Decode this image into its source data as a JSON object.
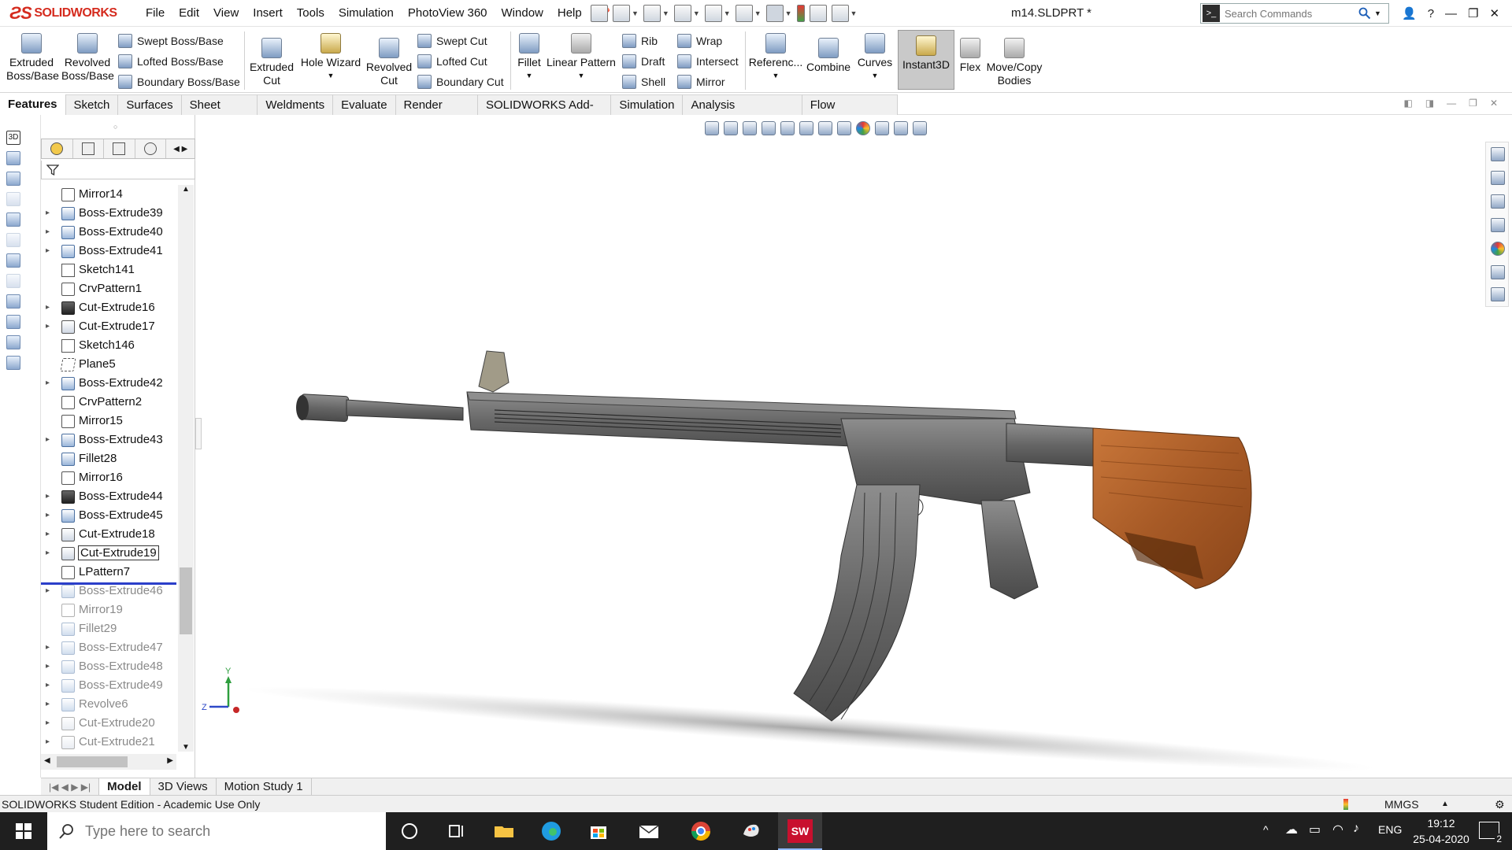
{
  "app": {
    "brand": "SOLIDWORKS",
    "doc_title": "m14.SLDPRT *"
  },
  "menu": [
    "File",
    "Edit",
    "View",
    "Insert",
    "Tools",
    "Simulation",
    "PhotoView 360",
    "Window",
    "Help"
  ],
  "search": {
    "placeholder": "Search Commands"
  },
  "toolbar": {
    "extruded_boss": [
      "Extruded",
      "Boss/Base"
    ],
    "revolved_boss": [
      "Revolved",
      "Boss/Base"
    ],
    "swept_boss": "Swept Boss/Base",
    "lofted_boss": "Lofted Boss/Base",
    "boundary_boss": "Boundary Boss/Base",
    "extruded_cut": [
      "Extruded",
      "Cut"
    ],
    "hole_wizard": "Hole Wizard",
    "revolved_cut": [
      "Revolved",
      "Cut"
    ],
    "swept_cut": "Swept Cut",
    "lofted_cut": "Lofted Cut",
    "boundary_cut": "Boundary Cut",
    "fillet": "Fillet",
    "linear_pattern": "Linear Pattern",
    "rib": "Rib",
    "draft": "Draft",
    "shell": "Shell",
    "wrap": "Wrap",
    "intersect": "Intersect",
    "mirror": "Mirror",
    "reference": "Referenc...",
    "combine": "Combine",
    "curves": "Curves",
    "instant3d": "Instant3D",
    "flex": "Flex",
    "move_copy": [
      "Move/Copy",
      "Bodies"
    ]
  },
  "tabs": [
    "Features",
    "Sketch",
    "Surfaces",
    "Sheet Metal",
    "Weldments",
    "Evaluate",
    "Render Tools",
    "SOLIDWORKS Add-Ins",
    "Simulation",
    "Analysis Preparation",
    "Flow Simulation"
  ],
  "tree": [
    {
      "label": "Mirror14",
      "kind": "pattern",
      "expandable": false
    },
    {
      "label": "Boss-Extrude39",
      "kind": "boss",
      "expandable": true
    },
    {
      "label": "Boss-Extrude40",
      "kind": "boss",
      "expandable": true
    },
    {
      "label": "Boss-Extrude41",
      "kind": "boss",
      "expandable": true
    },
    {
      "label": "Sketch141",
      "kind": "sketch",
      "expandable": false
    },
    {
      "label": "CrvPattern1",
      "kind": "pattern",
      "expandable": false
    },
    {
      "label": "Cut-Extrude16",
      "kind": "dark",
      "expandable": true
    },
    {
      "label": "Cut-Extrude17",
      "kind": "cut",
      "expandable": true
    },
    {
      "label": "Sketch146",
      "kind": "sketch",
      "expandable": false
    },
    {
      "label": "Plane5",
      "kind": "plane",
      "expandable": false
    },
    {
      "label": "Boss-Extrude42",
      "kind": "boss",
      "expandable": true
    },
    {
      "label": "CrvPattern2",
      "kind": "pattern",
      "expandable": false
    },
    {
      "label": "Mirror15",
      "kind": "pattern",
      "expandable": false
    },
    {
      "label": "Boss-Extrude43",
      "kind": "boss",
      "expandable": true
    },
    {
      "label": "Fillet28",
      "kind": "boss",
      "expandable": false
    },
    {
      "label": "Mirror16",
      "kind": "pattern",
      "expandable": false
    },
    {
      "label": "Boss-Extrude44",
      "kind": "dark",
      "expandable": true
    },
    {
      "label": "Boss-Extrude45",
      "kind": "boss",
      "expandable": true
    },
    {
      "label": "Cut-Extrude18",
      "kind": "cut",
      "expandable": true
    },
    {
      "label": "Cut-Extrude19",
      "kind": "cut",
      "expandable": true,
      "selected": true
    },
    {
      "label": "LPattern7",
      "kind": "pattern",
      "expandable": false
    },
    {
      "label": "Boss-Extrude46",
      "kind": "boss",
      "expandable": true,
      "suppressed": true
    },
    {
      "label": "Mirror19",
      "kind": "pattern",
      "expandable": false,
      "suppressed": true
    },
    {
      "label": "Fillet29",
      "kind": "boss",
      "expandable": false,
      "suppressed": true
    },
    {
      "label": "Boss-Extrude47",
      "kind": "boss",
      "expandable": true,
      "suppressed": true
    },
    {
      "label": "Boss-Extrude48",
      "kind": "boss",
      "expandable": true,
      "suppressed": true
    },
    {
      "label": "Boss-Extrude49",
      "kind": "boss",
      "expandable": true,
      "suppressed": true
    },
    {
      "label": "Revolve6",
      "kind": "boss",
      "expandable": true,
      "suppressed": true
    },
    {
      "label": "Cut-Extrude20",
      "kind": "cut",
      "expandable": true,
      "suppressed": true
    },
    {
      "label": "Cut-Extrude21",
      "kind": "cut",
      "expandable": true,
      "suppressed": true
    }
  ],
  "bottom_tabs": [
    "Model",
    "3D Views",
    "Motion Study 1"
  ],
  "status": {
    "left": "SOLIDWORKS Student Edition - Academic Use Only",
    "units": "MMGS"
  },
  "triad": {
    "y": "Y",
    "z": "Z"
  },
  "taskbar": {
    "search_placeholder": "Type here to search",
    "lang": "ENG",
    "time": "19:12",
    "date": "25-04-2020",
    "notifications": "2"
  },
  "colors": {
    "stock": "#b5642d",
    "body": "#6a6a6a",
    "rollback": "#2b3fc9",
    "brand": "#d52b1e"
  }
}
